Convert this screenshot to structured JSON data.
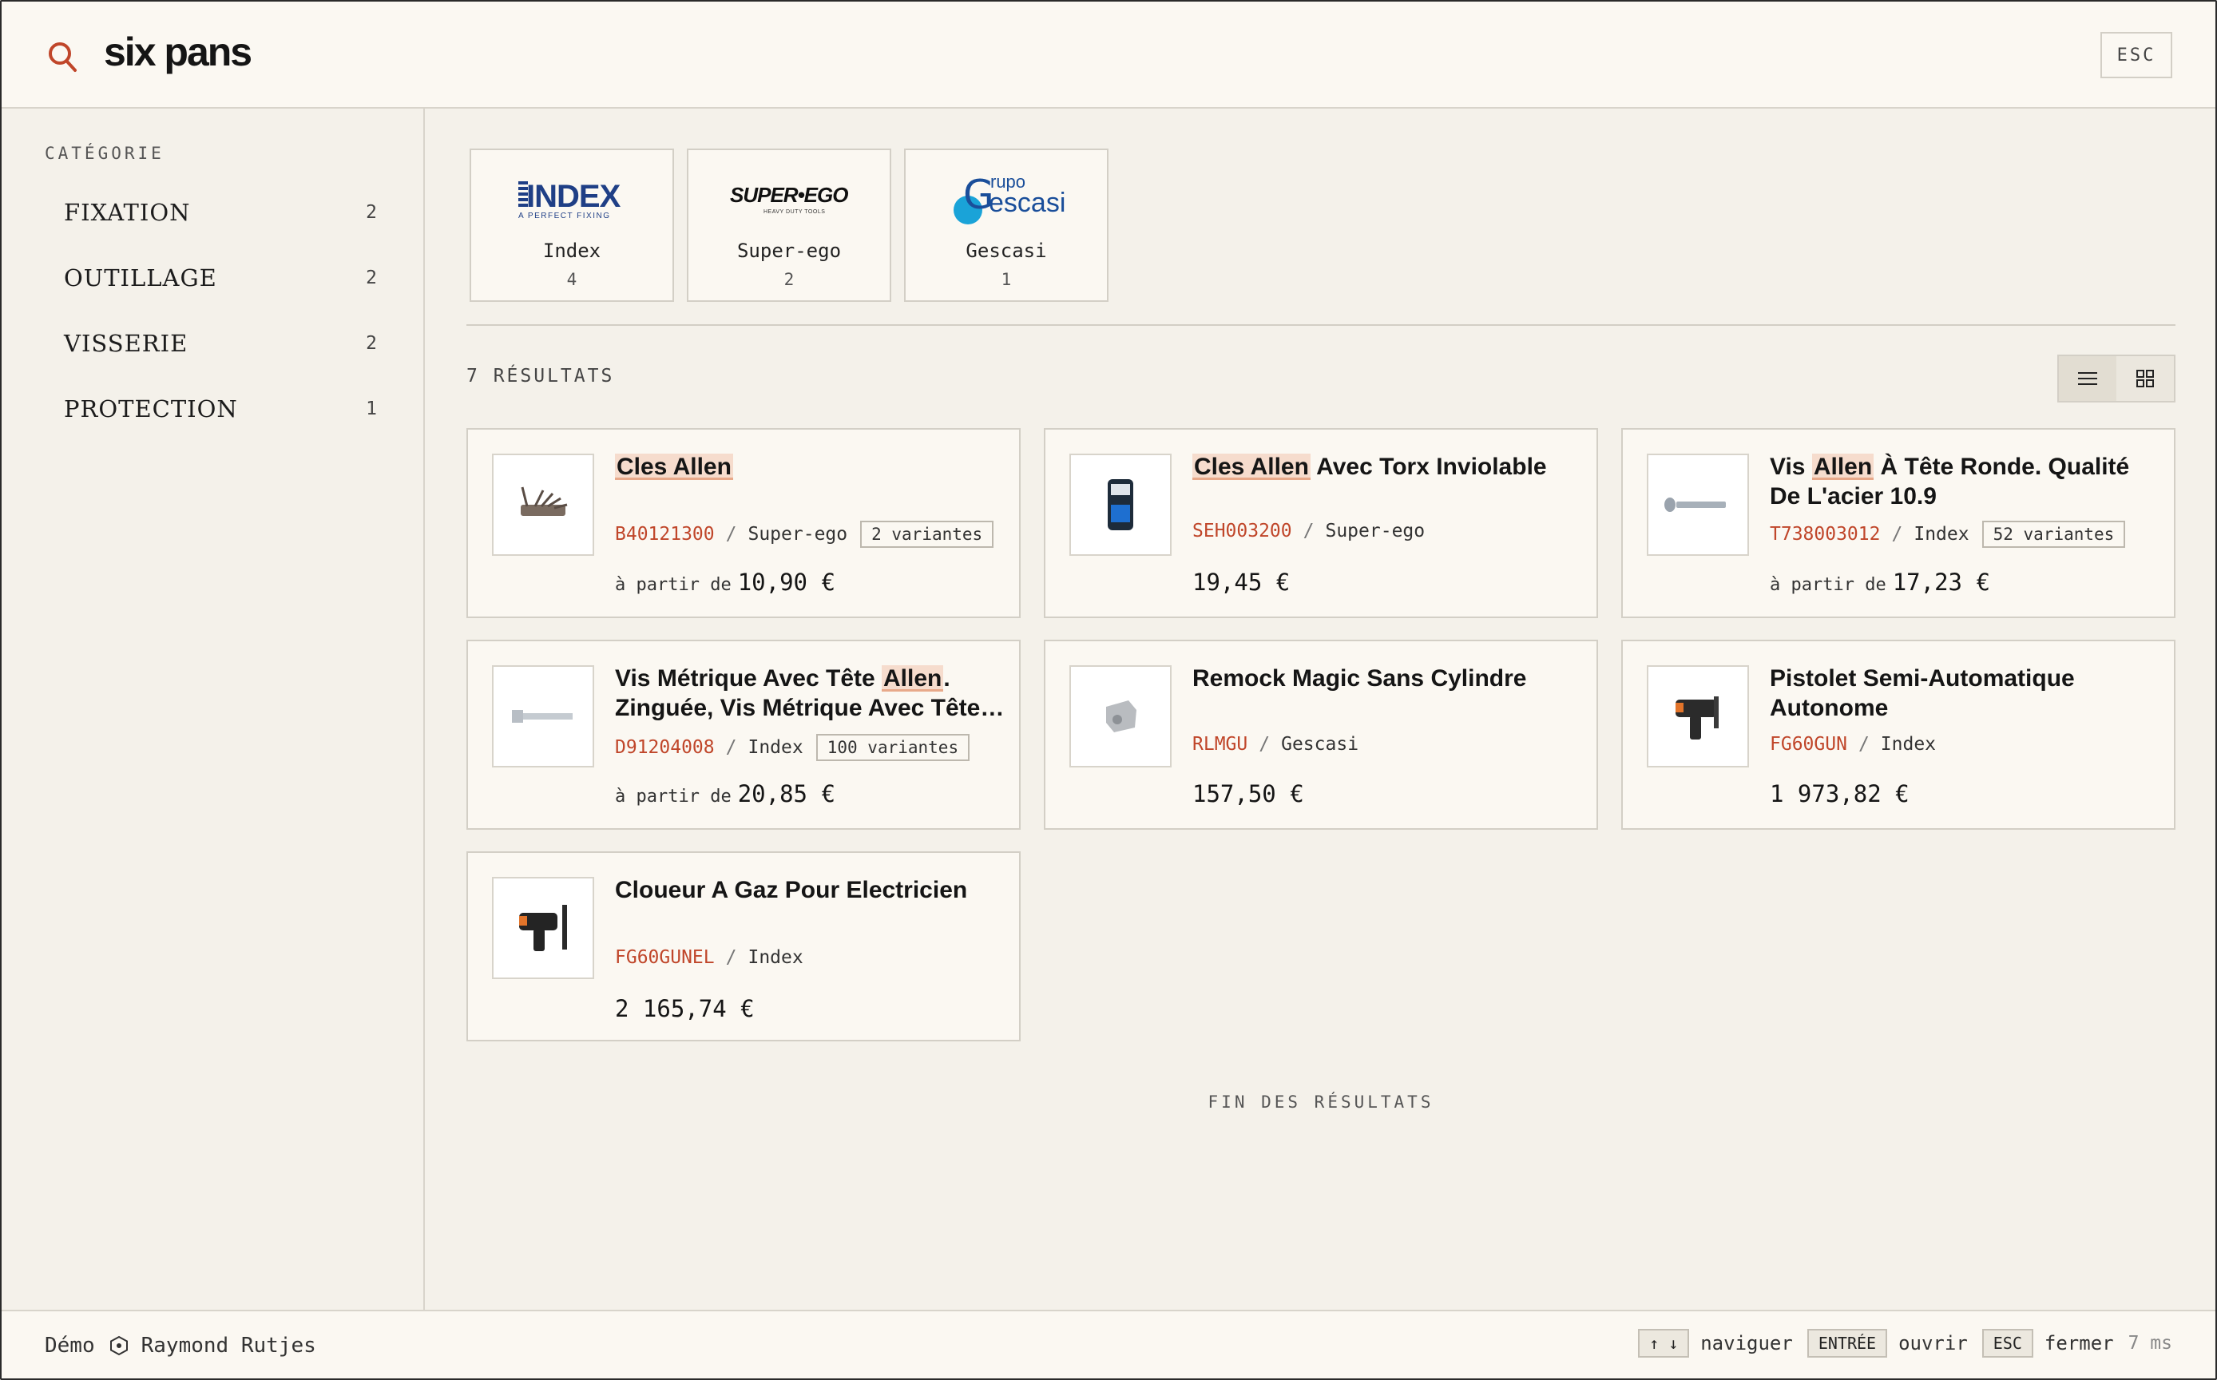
{
  "search": {
    "query": "six pans",
    "esc_label": "ESC"
  },
  "sidebar": {
    "heading": "CATÉGORIE",
    "categories": [
      {
        "label": "FIXATION",
        "count": "2"
      },
      {
        "label": "OUTILLAGE",
        "count": "2"
      },
      {
        "label": "VISSERIE",
        "count": "2"
      },
      {
        "label": "PROTECTION",
        "count": "1"
      }
    ]
  },
  "brands": [
    {
      "name": "Index",
      "count": "4",
      "logo_text": "INDEX",
      "logo_sub": "A PERFECT FIXING"
    },
    {
      "name": "Super-ego",
      "count": "2",
      "logo_text": "SUPER•EGO",
      "logo_sub": "HEAVY DUTY TOOLS"
    },
    {
      "name": "Gescasi",
      "count": "1",
      "logo_text": "Grupo Gescasi",
      "logo_sub": ""
    }
  ],
  "results": {
    "count_label": "7 RÉSULTATS",
    "end_label": "FIN DES RÉSULTATS",
    "view_modes": [
      "list-icon",
      "grid-icon"
    ],
    "products": [
      {
        "title_pre": "",
        "title_hl": "Cles Allen",
        "title_post": "",
        "sku": "B40121300",
        "brand": "Super-ego",
        "variants": "2 variantes",
        "price_prefix": "à partir de",
        "price": "10,90 €",
        "thumb": "allen-key-set"
      },
      {
        "title_pre": "",
        "title_hl": "Cles Allen",
        "title_post": " Avec Torx Inviolable",
        "sku": "SEH003200",
        "brand": "Super-ego",
        "variants": "",
        "price_prefix": "",
        "price": "19,45 €",
        "thumb": "torx-pack"
      },
      {
        "title_pre": "Vis ",
        "title_hl": "Allen",
        "title_post": " À Tête Ronde. Qualité De L'acier 10.9",
        "sku": "T738003012",
        "brand": "Index",
        "variants": "52 variantes",
        "price_prefix": "à partir de",
        "price": "17,23 €",
        "thumb": "round-head-screw"
      },
      {
        "title_pre": "Vis Métrique Avec Tête ",
        "title_hl": "Allen",
        "title_post": ". Zinguée, Vis Métrique Avec Tête…",
        "sku": "D91204008",
        "brand": "Index",
        "variants": "100 variantes",
        "price_prefix": "à partir de",
        "price": "20,85 €",
        "thumb": "metric-screw"
      },
      {
        "title_pre": "Remock Magic Sans Cylindre",
        "title_hl": "",
        "title_post": "",
        "sku": "RLMGU",
        "brand": "Gescasi",
        "variants": "",
        "price_prefix": "",
        "price": "157,50 €",
        "thumb": "lock-part"
      },
      {
        "title_pre": "Pistolet Semi-Automatique Autonome",
        "title_hl": "",
        "title_post": "",
        "sku": "FG60GUN",
        "brand": "Index",
        "variants": "",
        "price_prefix": "",
        "price": "1 973,82 €",
        "thumb": "nail-gun"
      },
      {
        "title_pre": "Cloueur A Gaz Pour Electricien",
        "title_hl": "",
        "title_post": "",
        "sku": "FG60GUNEL",
        "brand": "Index",
        "variants": "",
        "price_prefix": "",
        "price": "2 165,74 €",
        "thumb": "gas-nailer"
      }
    ]
  },
  "footer": {
    "demo_label": "Démo",
    "user_name": "Raymond Rutjes",
    "nav_key": "↑ ↓",
    "nav_label": "naviguer",
    "enter_key": "ENTRÉE",
    "enter_label": "ouvrir",
    "esc_key": "ESC",
    "esc_label": "fermer",
    "timing": "7 ms"
  },
  "colors": {
    "accent": "#c0462a",
    "background": "#f4f1ea",
    "card": "#fbf8f2",
    "highlight": "#f6dccd"
  }
}
